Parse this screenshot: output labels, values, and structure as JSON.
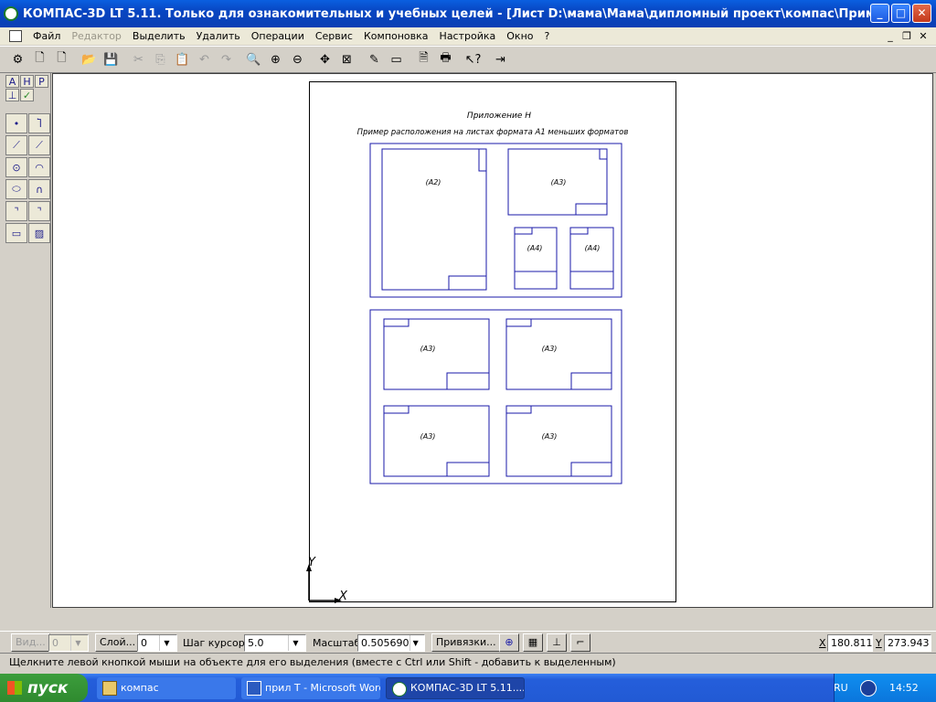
{
  "window": {
    "title": "КОМПАС-3D LT 5.11. Только для ознакомительных и учебных целей - [Лист D:\\мама\\Мама\\дипломный проект\\компас\\Пример расположения..."
  },
  "menu": {
    "items": [
      {
        "label": "Файл",
        "enabled": true
      },
      {
        "label": "Редактор",
        "enabled": false
      },
      {
        "label": "Выделить",
        "enabled": true
      },
      {
        "label": "Удалить",
        "enabled": true
      },
      {
        "label": "Операции",
        "enabled": true
      },
      {
        "label": "Сервис",
        "enabled": true
      },
      {
        "label": "Компоновка",
        "enabled": true
      },
      {
        "label": "Настройка",
        "enabled": true
      },
      {
        "label": "Окно",
        "enabled": true
      },
      {
        "label": "?",
        "enabled": true
      }
    ]
  },
  "toolbar_icons": [
    "properties-icon",
    "new-document-icon",
    "new-sheet-icon",
    "open-folder-icon",
    "save-icon",
    "cut-icon",
    "copy-icon",
    "paste-icon",
    "undo-icon",
    "redo-icon",
    "zoom-icon",
    "zoom-in-icon",
    "zoom-out-icon",
    "pan-icon",
    "zoom-all-icon",
    "pencil-icon",
    "frame-icon",
    "preview-icon",
    "print-icon",
    "help-pointer-icon",
    "exit-icon"
  ],
  "left_tools": {
    "tabs": [
      "A",
      "H",
      "P"
    ],
    "tools": [
      "point-icon",
      "polyline-icon",
      "segment-icon",
      "parallel-line-icon",
      "circle-icon",
      "arc-icon",
      "ellipse-icon",
      "spline-icon",
      "chamfer-icon",
      "fillet-icon",
      "rectangle-icon",
      "hatch-icon"
    ]
  },
  "drawing": {
    "heading": "Приложение Н",
    "subheading": "Пример расположения на листах формата А1 меньших форматов",
    "labels": {
      "a2": "(А2)",
      "a3": "(А3)",
      "a4": "(А4)"
    },
    "axis_x": "X",
    "axis_y": "Y"
  },
  "bottombar": {
    "view_label": "Вид...",
    "view_value": "0",
    "layer_label": "Слой...",
    "layer_value": "0",
    "step_label": "Шаг курсора",
    "step_value": "5.0",
    "scale_label": "Масштаб",
    "scale_value": "0.505690",
    "snaps_label": "Привязки...",
    "x_label": "X",
    "x_value": "180.811",
    "y_label": "Y",
    "y_value": "273.943"
  },
  "status": "Щелкните левой кнопкой мыши на объекте для его выделения (вместе с Ctrl или Shift - добавить к выделенным)",
  "taskbar": {
    "start": "пуск",
    "tasks": [
      {
        "label": "компас",
        "active": false
      },
      {
        "label": "прил Т - Microsoft Word",
        "active": false
      },
      {
        "label": "КОМПАС-3D LT 5.11....",
        "active": true
      }
    ],
    "lang": "RU",
    "clock": "14:52"
  }
}
